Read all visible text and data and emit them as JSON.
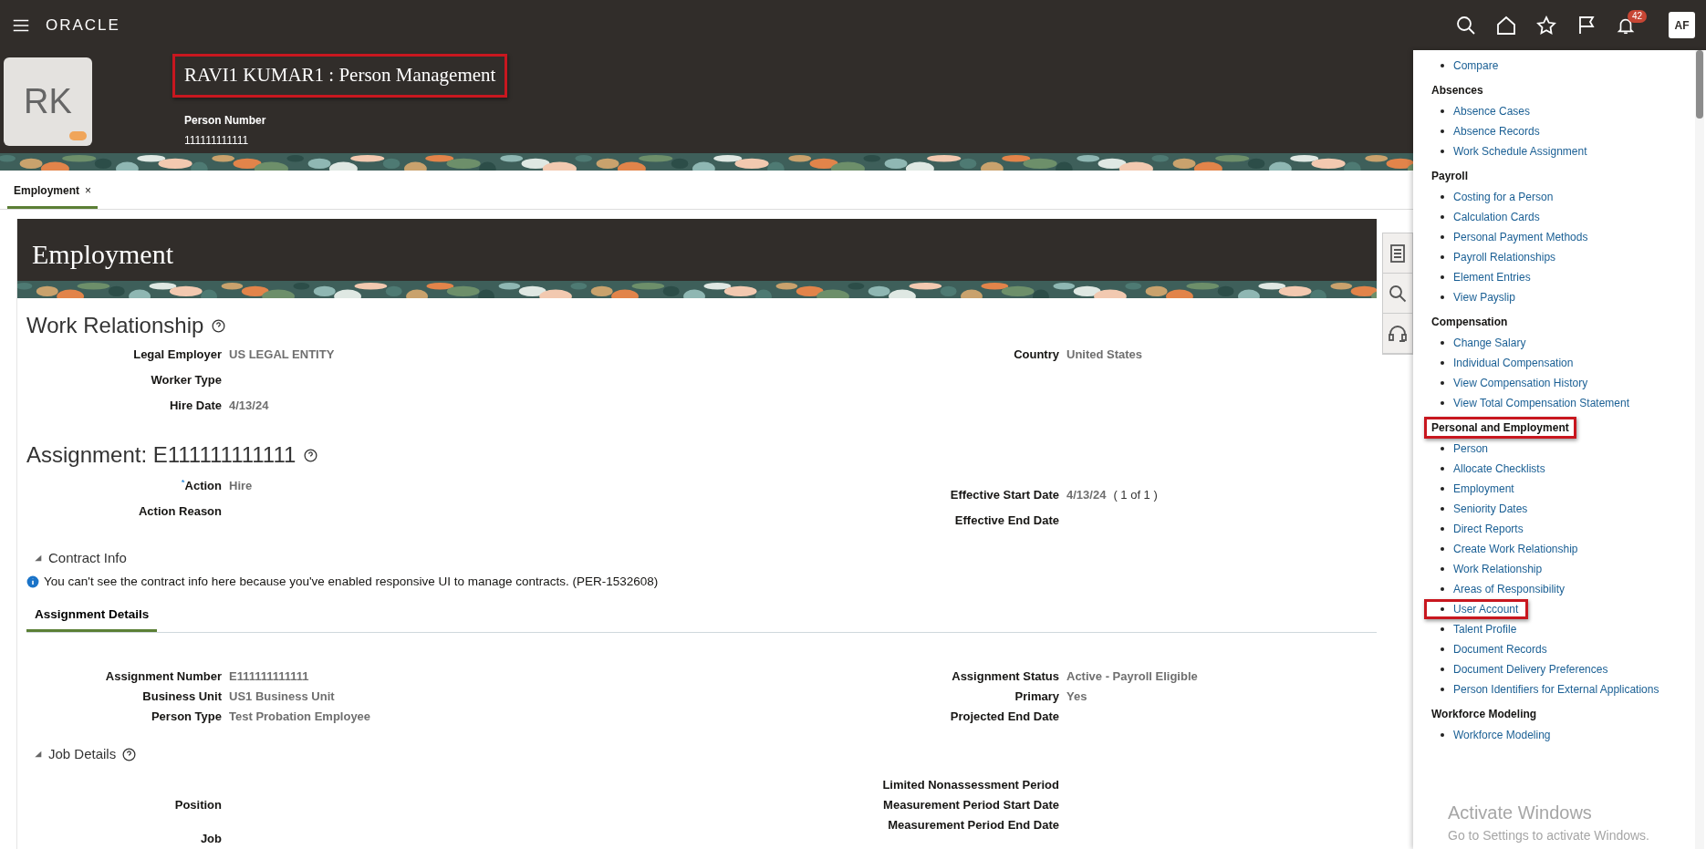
{
  "topbar": {
    "logo": "ORACLE",
    "notifications_count": "42",
    "user_initials": "AF"
  },
  "person": {
    "initials": "RK",
    "title": "RAVI1 KUMAR1 : Person Management",
    "title_highlighted": true,
    "number_label": "Person Number",
    "number": "111111111111"
  },
  "tabs": [
    {
      "label": "Employment",
      "selected": true,
      "close": "×"
    }
  ],
  "page_title": "Employment",
  "work_relationship": {
    "heading": "Work Relationship",
    "left": [
      {
        "label": "Legal Employer",
        "value": "US LEGAL ENTITY"
      },
      {
        "label": "Worker Type"
      },
      {
        "label": "Hire Date",
        "value": "4/13/24"
      }
    ],
    "right": [
      {
        "label": "Country",
        "value": "United States"
      }
    ]
  },
  "assignment": {
    "heading": "Assignment: E111111111111",
    "left": [
      {
        "label": "Action",
        "value": "Hire",
        "marker": "*"
      },
      {
        "label": "Action Reason"
      }
    ],
    "right": [
      {
        "label": "Effective Start Date",
        "value": "4/13/24",
        "extra": "( 1 of 1 )"
      },
      {
        "label": "Effective End Date"
      }
    ]
  },
  "contract_info": {
    "label": "Contract Info",
    "expanded": true,
    "message": "You can't see the contract info here because you've enabled responsive UI to manage contracts. (PER-1532608)"
  },
  "subtabs": [
    {
      "label": "Assignment Details",
      "selected": true
    }
  ],
  "assignment_details": {
    "left": [
      {
        "label": "Assignment Number",
        "value": "E111111111111"
      },
      {
        "label": "Business Unit",
        "value": "US1 Business Unit"
      },
      {
        "label": "Person Type",
        "value": "Test Probation Employee"
      }
    ],
    "right": [
      {
        "label": "Assignment Status",
        "value": "Active - Payroll Eligible"
      },
      {
        "label": "Primary",
        "value": "Yes"
      },
      {
        "label": "Projected End Date"
      }
    ]
  },
  "job_details": {
    "label": "Job Details",
    "expanded": true,
    "left": [
      {
        "label": "Position"
      },
      {
        "label": "Job"
      }
    ],
    "right": [
      {
        "label": "Limited Nonassessment Period"
      },
      {
        "label": "Measurement Period Start Date"
      },
      {
        "label": "Measurement Period End Date"
      }
    ]
  },
  "sidebar": {
    "groups": [
      {
        "links": [
          {
            "label": "Compare",
            "highlighted": false
          }
        ]
      },
      {
        "heading": "Absences",
        "highlighted": false,
        "links": [
          {
            "label": "Absence Cases",
            "highlighted": false
          },
          {
            "label": "Absence Records",
            "highlighted": false
          },
          {
            "label": "Work Schedule Assignment",
            "highlighted": false
          }
        ]
      },
      {
        "heading": "Payroll",
        "highlighted": false,
        "links": [
          {
            "label": "Costing for a Person",
            "highlighted": false
          },
          {
            "label": "Calculation Cards",
            "highlighted": false
          },
          {
            "label": "Personal Payment Methods",
            "highlighted": false
          },
          {
            "label": "Payroll Relationships",
            "highlighted": false
          },
          {
            "label": "Element Entries",
            "highlighted": false
          },
          {
            "label": "View Payslip",
            "highlighted": false
          }
        ]
      },
      {
        "heading": "Compensation",
        "highlighted": false,
        "links": [
          {
            "label": "Change Salary",
            "highlighted": false
          },
          {
            "label": "Individual Compensation",
            "highlighted": false
          },
          {
            "label": "View Compensation History",
            "highlighted": false
          },
          {
            "label": "View Total Compensation Statement",
            "highlighted": false
          }
        ]
      },
      {
        "heading": "Personal and Employment",
        "highlighted": true,
        "links": [
          {
            "label": "Person",
            "highlighted": false
          },
          {
            "label": "Allocate Checklists",
            "highlighted": false
          },
          {
            "label": "Employment",
            "highlighted": false
          },
          {
            "label": "Seniority Dates",
            "highlighted": false
          },
          {
            "label": "Direct Reports",
            "highlighted": false
          },
          {
            "label": "Create Work Relationship",
            "highlighted": false
          },
          {
            "label": "Work Relationship",
            "highlighted": false
          },
          {
            "label": "Areas of Responsibility",
            "highlighted": false
          },
          {
            "label": "User Account",
            "highlighted": true
          },
          {
            "label": "Talent Profile",
            "highlighted": false
          },
          {
            "label": "Document Records",
            "highlighted": false
          },
          {
            "label": "Document Delivery Preferences",
            "highlighted": false
          },
          {
            "label": "Person Identifiers for External Applications",
            "highlighted": false
          }
        ]
      },
      {
        "heading": "Workforce Modeling",
        "highlighted": false,
        "links": [
          {
            "label": "Workforce Modeling",
            "highlighted": false
          }
        ]
      }
    ]
  },
  "os_notice": {
    "title": "Activate Windows",
    "subtitle": "Go to Settings to activate Windows."
  }
}
